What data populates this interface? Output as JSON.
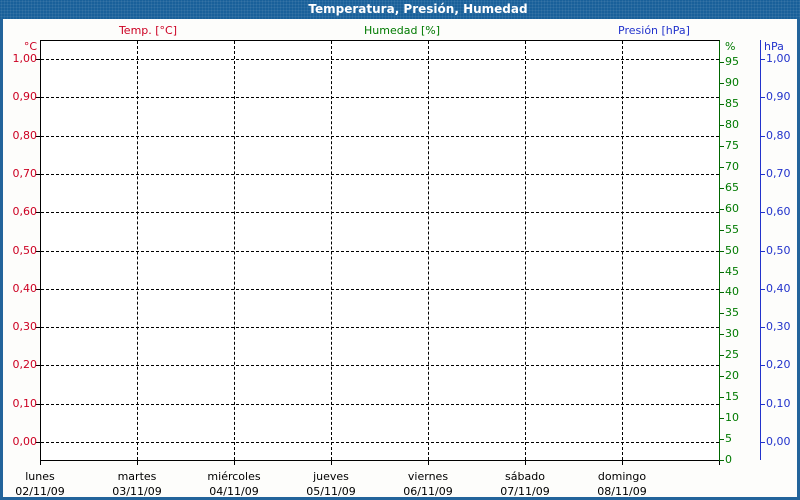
{
  "window": {
    "title": "Temperatura, Presión, Humedad",
    "title_bar_bg": "#19609A",
    "frame_border_color": "#23649B",
    "background": "#FFFFFF"
  },
  "legend": {
    "items": [
      {
        "label": "Temp. [°C]",
        "color": "#CC0022"
      },
      {
        "label": "Humedad [%]",
        "color": "#007A00"
      },
      {
        "label": "Presión [hPa]",
        "color": "#2233CC"
      }
    ]
  },
  "chart_data": {
    "type": "line",
    "title": "Temperatura, Presión, Humedad",
    "grid": "dashed black, on",
    "legend_position": "top",
    "series": [
      {
        "name": "Temp. [°C]",
        "unit": "°C",
        "color": "#CC0022",
        "axis": "left",
        "values": []
      },
      {
        "name": "Humedad [%]",
        "unit": "%",
        "color": "#007A00",
        "axis": "right_inner",
        "values": []
      },
      {
        "name": "Presión [hPa]",
        "unit": "hPa",
        "color": "#2233CC",
        "axis": "right_outer",
        "values": []
      }
    ],
    "x_axis": {
      "days": [
        {
          "name": "lunes",
          "date": "02/11/09"
        },
        {
          "name": "martes",
          "date": "03/11/09"
        },
        {
          "name": "miércoles",
          "date": "04/11/09"
        },
        {
          "name": "jueves",
          "date": "05/11/09"
        },
        {
          "name": "viernes",
          "date": "06/11/09"
        },
        {
          "name": "sábado",
          "date": "07/11/09"
        },
        {
          "name": "domingo",
          "date": "08/11/09"
        }
      ]
    },
    "y_axis_left": {
      "unit": "°C",
      "color": "#CC0022",
      "min": 0.0,
      "max": 1.0,
      "step": 0.1,
      "ticks": [
        "1,00",
        "0,90",
        "0,80",
        "0,70",
        "0,60",
        "0,50",
        "0,40",
        "0,30",
        "0,20",
        "0,10",
        "0,00"
      ]
    },
    "y_axis_right_inner": {
      "unit": "%",
      "color": "#007A00",
      "min": 0,
      "max": 100,
      "step": 5,
      "ticks": [
        "95",
        "90",
        "85",
        "80",
        "75",
        "70",
        "65",
        "60",
        "55",
        "50",
        "45",
        "40",
        "35",
        "30",
        "25",
        "20",
        "15",
        "10",
        "5",
        "0"
      ]
    },
    "y_axis_right_outer": {
      "unit": "hPa",
      "color": "#2233CC",
      "min": 0.0,
      "max": 1.0,
      "step": 0.1,
      "ticks": [
        "1,00",
        "0,90",
        "0,80",
        "0,70",
        "0,60",
        "0,50",
        "0,40",
        "0,30",
        "0,20",
        "0,10",
        "0,00"
      ]
    }
  }
}
